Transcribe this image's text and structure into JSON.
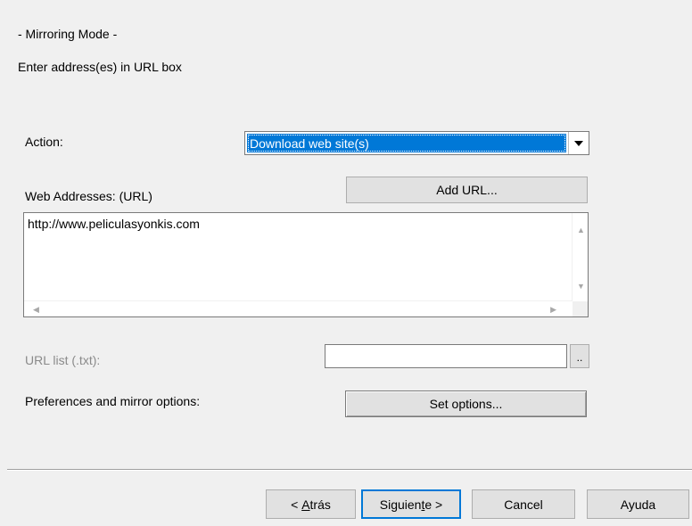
{
  "header": {
    "mode": "- Mirroring Mode -",
    "instruction": "Enter address(es) in URL box"
  },
  "action": {
    "label": "Action:",
    "selected": "Download web site(s)"
  },
  "web_addresses": {
    "label": "Web Addresses: (URL)",
    "add_url_button": "Add URL...",
    "value": "http://www.peliculasyonkis.com"
  },
  "url_list": {
    "label": "URL list (.txt):",
    "value": "",
    "browse_button": ".."
  },
  "preferences": {
    "label": "Preferences and mirror options:",
    "set_options_button": "Set options..."
  },
  "footer": {
    "back_prefix": "< ",
    "back_accel": "A",
    "back_rest": "trás",
    "next_prefix": "Siguien",
    "next_accel": "t",
    "next_rest": "e >",
    "cancel": "Cancel",
    "help": "Ayuda"
  },
  "icons": {
    "dropdown": "chevron-down-icon",
    "scroll_up": "scroll-up-arrow-icon",
    "scroll_down": "scroll-down-arrow-icon",
    "scroll_left": "scroll-left-arrow-icon",
    "scroll_right": "scroll-right-arrow-icon"
  },
  "colors": {
    "selection": "#0078d7",
    "window_bg": "#f0f0f0"
  }
}
